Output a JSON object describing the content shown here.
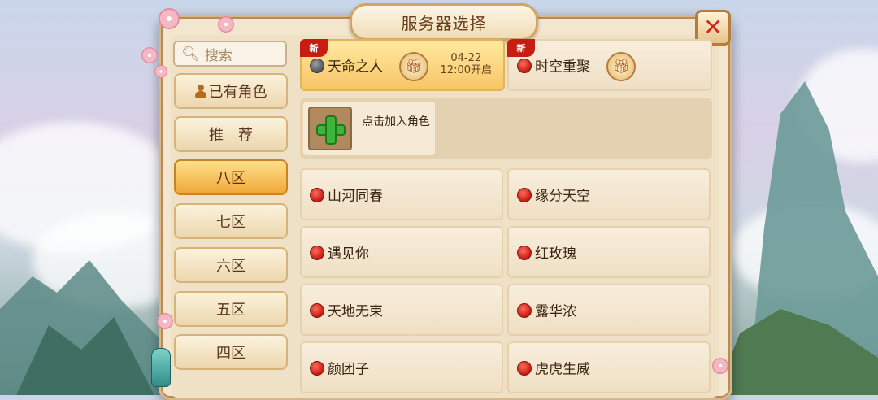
{
  "header": {
    "title": "服务器选择"
  },
  "search": {
    "placeholder": "搜索"
  },
  "sidebar": {
    "items": [
      {
        "label": "已有角色",
        "active": false
      },
      {
        "label": "推　荐",
        "active": false
      },
      {
        "label": "八区",
        "active": true
      },
      {
        "label": "七区",
        "active": false
      },
      {
        "label": "六区",
        "active": false
      },
      {
        "label": "五区",
        "active": false
      },
      {
        "label": "四区",
        "active": false
      }
    ]
  },
  "featured": [
    {
      "name": "天命之人",
      "badge": "新",
      "status": "gray",
      "date": "04-22",
      "time": "12:00开启"
    },
    {
      "name": "时空重聚",
      "badge": "新",
      "status": "red"
    }
  ],
  "add_role": {
    "label": "点击加入角色"
  },
  "servers": [
    {
      "name": "山河同春",
      "status": "red"
    },
    {
      "name": "缘分天空",
      "status": "red"
    },
    {
      "name": "遇见你",
      "status": "red"
    },
    {
      "name": "红玫瑰",
      "status": "red"
    },
    {
      "name": "天地无束",
      "status": "red"
    },
    {
      "name": "露华浓",
      "status": "red"
    },
    {
      "name": "颜团子",
      "status": "red"
    },
    {
      "name": "虎虎生威",
      "status": "red"
    }
  ],
  "colors": {
    "active_tab": "#f0a838",
    "status_red": "#c81b12",
    "status_gray": "#54585c",
    "panel": "#f3e6cf"
  },
  "icons": {
    "close": "close-icon",
    "search": "search-icon",
    "gift": "gift-icon",
    "add": "plus-icon"
  }
}
